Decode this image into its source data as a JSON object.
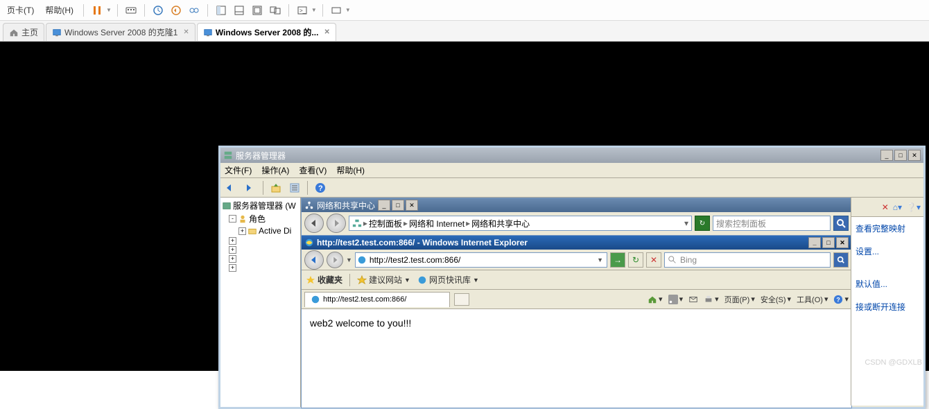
{
  "vmware": {
    "menus": {
      "tab": "页卡(T)",
      "help": "帮助(H)"
    },
    "tabs": [
      {
        "label": "主页",
        "icon": "home"
      },
      {
        "label": "Windows Server 2008 的克隆1",
        "icon": "vm"
      },
      {
        "label": "Windows Server 2008 的...",
        "icon": "vm",
        "active": true
      }
    ]
  },
  "server_manager": {
    "title": "服务器管理器",
    "menus": {
      "file": "文件(F)",
      "action": "操作(A)",
      "view": "查看(V)",
      "help": "帮助(H)"
    },
    "tree": {
      "root": "服务器管理器 (W",
      "roles": "角色",
      "active_dir": "Active Di"
    }
  },
  "network_center": {
    "title": "网络和共享中心",
    "breadcrumb": {
      "cp": "控制面板",
      "net": "网络和 Internet",
      "center": "网络和共享中心"
    },
    "search_placeholder": "搜索控制面板"
  },
  "ie": {
    "title": "http://test2.test.com:866/ - Windows Internet Explorer",
    "url": "http://test2.test.com:866/",
    "search_engine": "Bing",
    "fav_label": "收藏夹",
    "suggested": "建议网站",
    "quicknews": "网页快讯库",
    "tab_title": "http://test2.test.com:866/",
    "cmd": {
      "page": "页面(P)",
      "safety": "安全(S)",
      "tools": "工具(O)"
    },
    "page_content": "web2 welcome to you!!!"
  },
  "right_panel": {
    "link1": "查看完整映射",
    "link2": "设置...",
    "link3": "默认值...",
    "link4": "接或断开连接"
  },
  "watermark": "CSDN @GDXLB"
}
